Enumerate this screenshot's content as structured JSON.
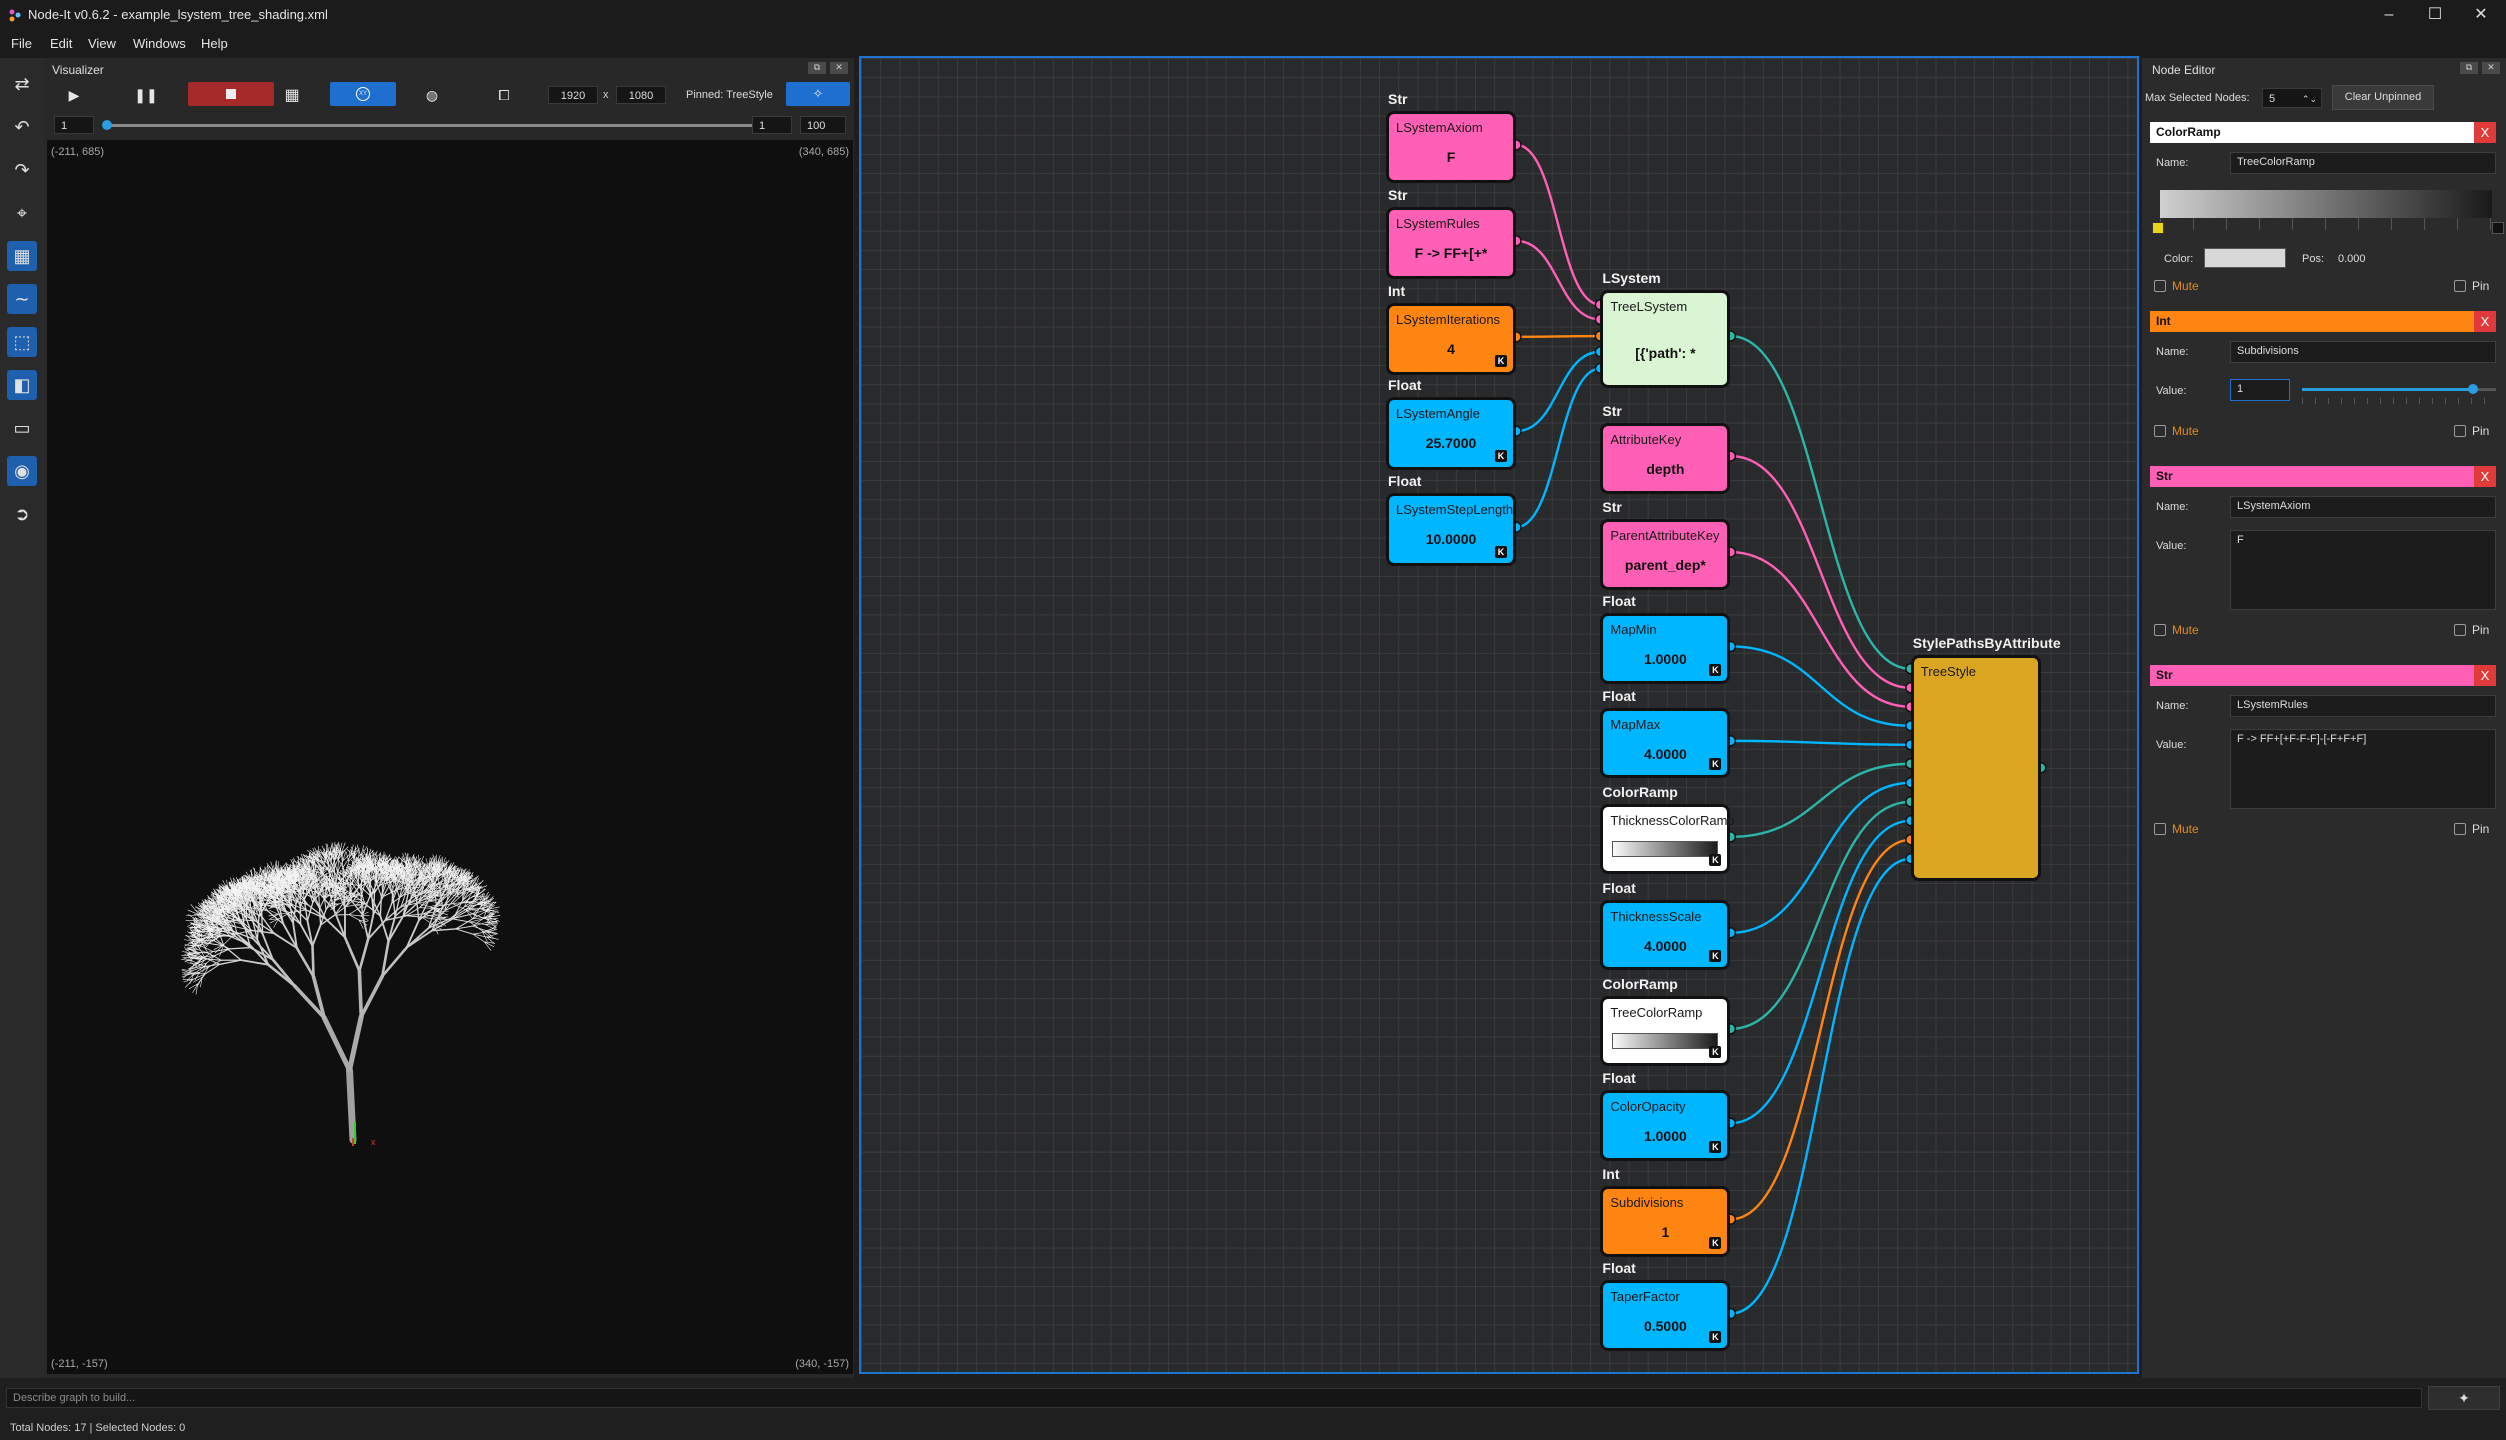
{
  "window": {
    "title": "Node-It v0.6.2 - example_lsystem_tree_shading.xml",
    "minimize": "–",
    "maximize": "☐",
    "close": "✕"
  },
  "menu": [
    "File",
    "Edit",
    "View",
    "Windows",
    "Help"
  ],
  "visualizer": {
    "title": "Visualizer",
    "width": "1920",
    "x_sep": "x",
    "height": "1080",
    "pinned_label": "Pinned: TreeStyle",
    "frame_start": "1",
    "frame_current": "1",
    "frame_end": "100",
    "coord_tl": "(-211, 685)",
    "coord_tr": "(340, 685)",
    "coord_bl": "(-211, -157)",
    "coord_br": "(340, -157)",
    "axis_x": "x"
  },
  "nodes": {
    "axiom": {
      "type": "Str",
      "name": "LSystemAxiom",
      "value": "F"
    },
    "rules": {
      "type": "Str",
      "name": "LSystemRules",
      "value": "F -> FF+[+*"
    },
    "iterations": {
      "type": "Int",
      "name": "LSystemIterations",
      "value": "4",
      "badge": "K"
    },
    "angle": {
      "type": "Float",
      "name": "LSystemAngle",
      "value": "25.7000",
      "badge": "K"
    },
    "steplength": {
      "type": "Float",
      "name": "LSystemStepLength",
      "value": "10.0000",
      "badge": "K"
    },
    "lsystem": {
      "type": "LSystem",
      "name": "TreeLSystem",
      "value": "[{'path': *"
    },
    "attrkey": {
      "type": "Str",
      "name": "AttributeKey",
      "value": "depth"
    },
    "parentkey": {
      "type": "Str",
      "name": "ParentAttributeKey",
      "value": "parent_dep*"
    },
    "mapmin": {
      "type": "Float",
      "name": "MapMin",
      "value": "1.0000",
      "badge": "K"
    },
    "mapmax": {
      "type": "Float",
      "name": "MapMax",
      "value": "4.0000",
      "badge": "K"
    },
    "thickramp": {
      "type": "ColorRamp",
      "name": "ThicknessColorRamp",
      "badge": "K"
    },
    "thickscale": {
      "type": "Float",
      "name": "ThicknessScale",
      "value": "4.0000",
      "badge": "K"
    },
    "treeramp": {
      "type": "ColorRamp",
      "name": "TreeColorRamp",
      "badge": "K"
    },
    "opacity": {
      "type": "Float",
      "name": "ColorOpacity",
      "value": "1.0000",
      "badge": "K"
    },
    "subdiv": {
      "type": "Int",
      "name": "Subdivisions",
      "value": "1",
      "badge": "K"
    },
    "taper": {
      "type": "Float",
      "name": "TaperFactor",
      "value": "0.5000",
      "badge": "K"
    },
    "style": {
      "type": "StylePathsByAttribute",
      "name": "TreeStyle"
    }
  },
  "colors": {
    "str": "#ff5fb5",
    "int": "#ff8512",
    "float": "#00b6ff",
    "ramp": "#ffffff",
    "lsystem": "#daf5d3",
    "style": "#daa520",
    "accent": "#1e6fcf"
  },
  "editor": {
    "title": "Node Editor",
    "max_label": "Max Selected Nodes:",
    "max_value": "5",
    "clear_label": "Clear Unpinned",
    "close_x": "X",
    "name_label": "Name:",
    "value_label": "Value:",
    "mute_label": "Mute",
    "pin_label": "Pin",
    "cards": [
      {
        "type": "ColorRamp",
        "name": "TreeColorRamp",
        "color_label": "Color:",
        "pos_label": "Pos:",
        "pos_value": "0.000"
      },
      {
        "type": "Int",
        "name": "Subdivisions",
        "value": "1",
        "slider_fraction": 0.88
      },
      {
        "type": "Str",
        "name": "LSystemAxiom",
        "value": "F"
      },
      {
        "type": "Str",
        "name": "LSystemRules",
        "value": "F -> FF+[+F-F-F]-[-F+F+F]"
      }
    ]
  },
  "prompt": {
    "placeholder": "Describe graph to build..."
  },
  "status": "Total Nodes: 17 | Selected Nodes: 0"
}
